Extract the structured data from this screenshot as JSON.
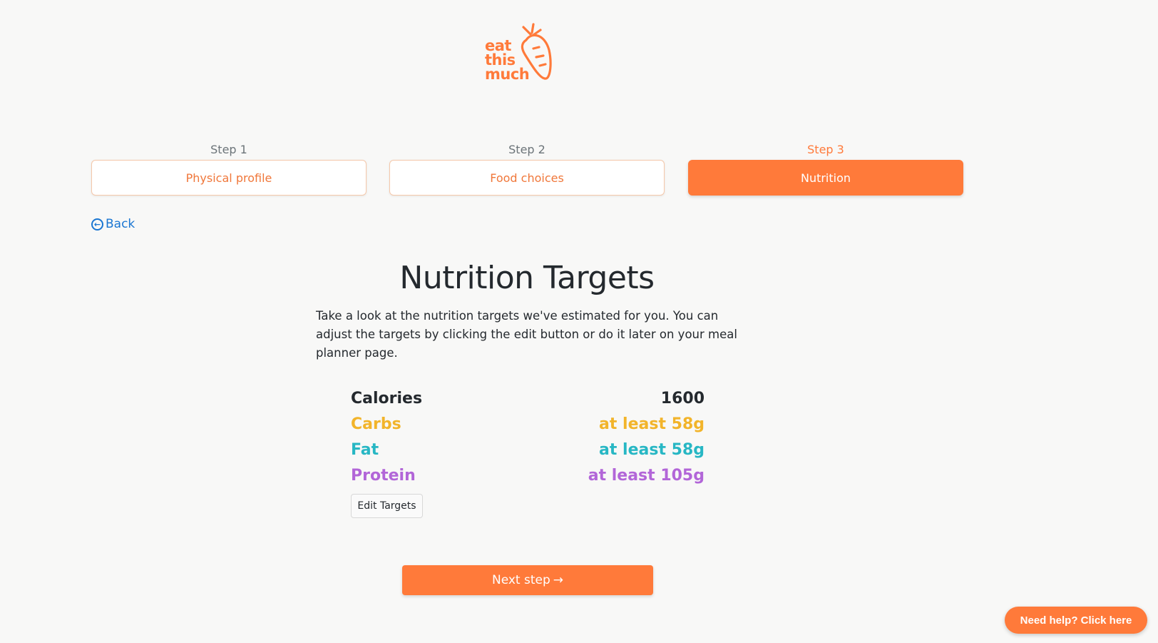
{
  "logo": {
    "line1": "eat",
    "line2": "this",
    "line3": "much",
    "icon": "carrot-icon"
  },
  "steps": [
    {
      "label": "Step 1",
      "button": "Physical profile",
      "active": false
    },
    {
      "label": "Step 2",
      "button": "Food choices",
      "active": false
    },
    {
      "label": "Step 3",
      "button": "Nutrition",
      "active": true
    }
  ],
  "back": {
    "label": "Back",
    "icon": "arrow-left-circle-icon"
  },
  "heading": "Nutrition Targets",
  "description": "Take a look at the nutrition targets we've estimated for you. You can adjust the targets by clicking the edit button or do it later on your meal planner page.",
  "nutrition": {
    "calories": {
      "label": "Calories",
      "value": "1600"
    },
    "carbs": {
      "label": "Carbs",
      "value": "at least 58g",
      "color": "#f2b42a"
    },
    "fat": {
      "label": "Fat",
      "value": "at least 58g",
      "color": "#27b7c4"
    },
    "protein": {
      "label": "Protein",
      "value": "at least 105g",
      "color": "#b266d8"
    }
  },
  "edit_button": "Edit Targets",
  "next_button": {
    "label": "Next step",
    "arrow": "→"
  },
  "help_button": "Need help? Click here",
  "colors": {
    "accent": "#ff7a3a",
    "link": "#1a76d2",
    "background": "#f8f8f7"
  }
}
